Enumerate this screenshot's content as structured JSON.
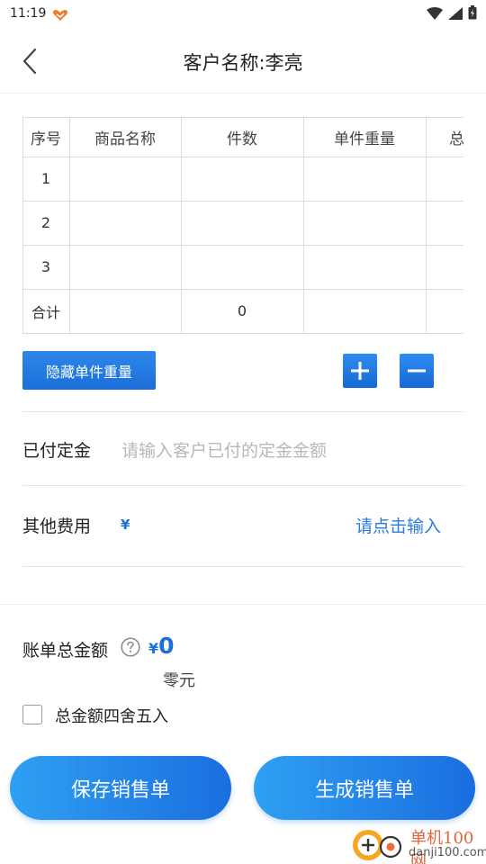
{
  "status_bar": {
    "time": "11:19"
  },
  "header": {
    "title": "客户名称:李亮"
  },
  "table": {
    "headers": [
      "序号",
      "商品名称",
      "件数",
      "单件重量",
      "总"
    ],
    "rows": [
      [
        "1",
        "",
        "",
        "",
        ""
      ],
      [
        "2",
        "",
        "",
        "",
        ""
      ],
      [
        "3",
        "",
        "",
        "",
        ""
      ]
    ],
    "total_row": [
      "合计",
      "",
      "0",
      "",
      ""
    ]
  },
  "actions": {
    "hide_weight_label": "隐藏单件重量"
  },
  "deposit": {
    "label": "已付定金",
    "placeholder": "请输入客户已付的定金金额"
  },
  "other_fees": {
    "label": "其他费用",
    "currency": "¥",
    "action": "请点击输入"
  },
  "summary": {
    "label": "账单总金额",
    "currency": "¥",
    "amount": "0",
    "amount_words": "零元",
    "round_label": "总金额四舍五入",
    "round_checked": false
  },
  "buttons": {
    "save": "保存销售单",
    "generate": "生成销售单"
  },
  "watermark": {
    "name": "单机100网",
    "domain": "danji100.com"
  },
  "colors": {
    "accent": "#1a6fd8",
    "link": "#2a7be0"
  }
}
